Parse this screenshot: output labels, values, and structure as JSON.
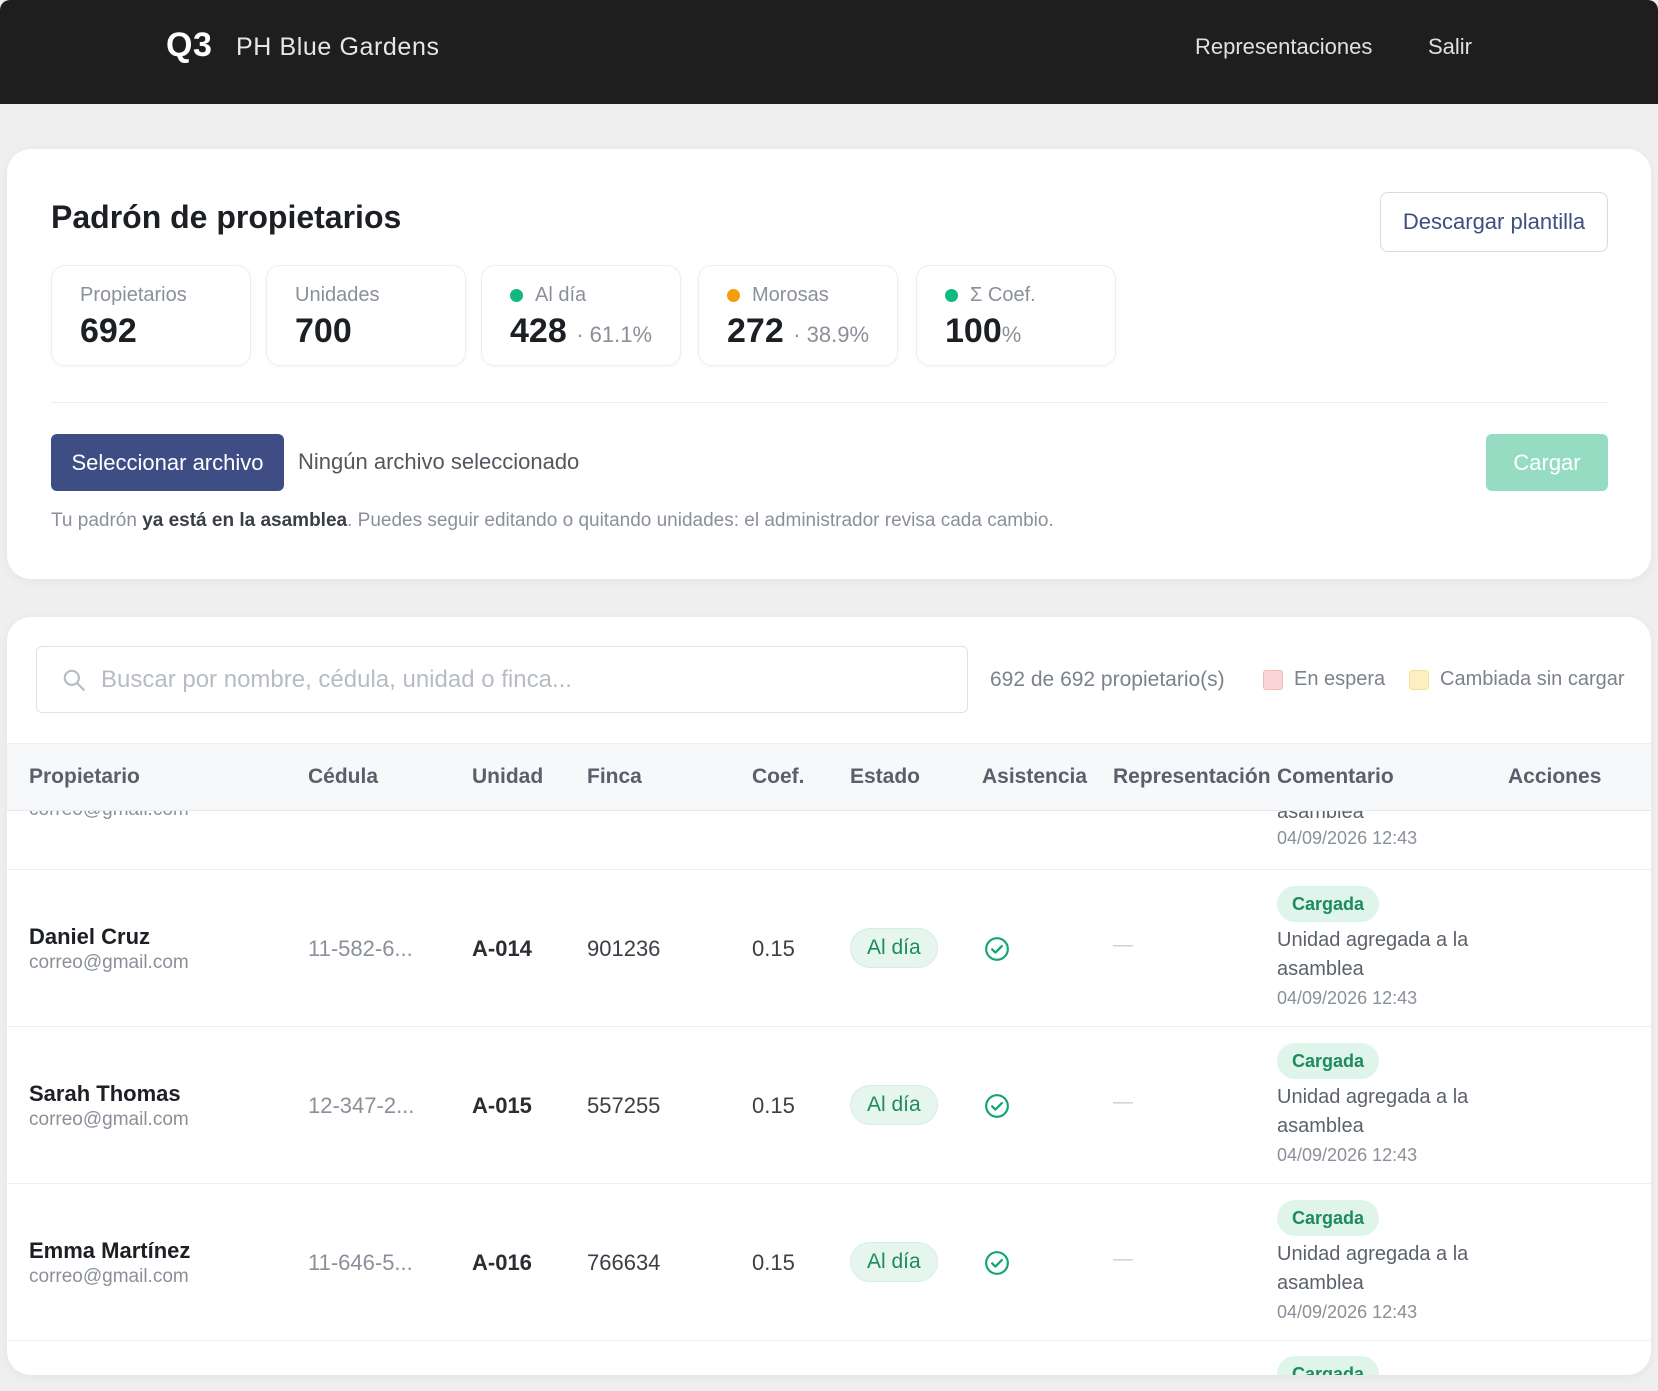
{
  "header": {
    "logo": "Q3",
    "project_name": "PH Blue Gardens",
    "nav": {
      "representaciones": "Representaciones",
      "salir": "Salir"
    }
  },
  "padron": {
    "title": "Padrón de propietarios",
    "download_button": "Descargar plantilla",
    "stats": [
      {
        "label": "Propietarios",
        "value": "692",
        "sub": ""
      },
      {
        "label": "Unidades",
        "value": "700",
        "sub": ""
      },
      {
        "label": "Al día",
        "value": "428",
        "sub": "· 61.1%",
        "dot_color": "#10b981"
      },
      {
        "label": "Morosas",
        "value": "272",
        "sub": "· 38.9%",
        "dot_color": "#f59e0b"
      },
      {
        "label": "Σ Coef.",
        "value": "100",
        "sub": "%",
        "dot_color": "#10b981"
      }
    ],
    "file_button": "Seleccionar archivo",
    "file_status": "Ningún archivo seleccionado",
    "upload_button": "Cargar",
    "note_prefix": "Tu padrón ",
    "note_bold": "ya está en la asamblea",
    "note_suffix": ". Puedes seguir editando o quitando unidades: el administrador revisa cada cambio."
  },
  "table": {
    "search_placeholder": "Buscar por nombre, cédula, unidad o finca...",
    "count": "692 de 692 propietario(s)",
    "legend": [
      {
        "label": "En espera",
        "color": "#fbd5d5"
      },
      {
        "label": "Cambiada sin cargar",
        "color": "#fdf0c0"
      }
    ],
    "columns": [
      "Propietario",
      "Cédula",
      "Unidad",
      "Finca",
      "Coef.",
      "Estado",
      "Asistencia",
      "Representación",
      "Comentario",
      "Acciones"
    ],
    "partial_top": {
      "email": "correo@gmail.com",
      "comment": "asamblea",
      "time": "04/09/2026 12:43"
    },
    "rows": [
      {
        "name": "Daniel Cruz",
        "email": "correo@gmail.com",
        "cedula": "11-582-6...",
        "unidad": "A-014",
        "finca": "901236",
        "coef": "0.15",
        "estado": "Al día",
        "representacion": "—",
        "badge": "Cargada",
        "comment": "Unidad agregada a la asamblea",
        "time": "04/09/2026 12:43"
      },
      {
        "name": "Sarah Thomas",
        "email": "correo@gmail.com",
        "cedula": "12-347-2...",
        "unidad": "A-015",
        "finca": "557255",
        "coef": "0.15",
        "estado": "Al día",
        "representacion": "—",
        "badge": "Cargada",
        "comment": "Unidad agregada a la asamblea",
        "time": "04/09/2026 12:43"
      },
      {
        "name": "Emma Martínez",
        "email": "correo@gmail.com",
        "cedula": "11-646-5...",
        "unidad": "A-016",
        "finca": "766634",
        "coef": "0.15",
        "estado": "Al día",
        "representacion": "—",
        "badge": "Cargada",
        "comment": "Unidad agregada a la asamblea",
        "time": "04/09/2026 12:43"
      }
    ],
    "partial_bottom": {
      "badge": "Cargada"
    }
  }
}
